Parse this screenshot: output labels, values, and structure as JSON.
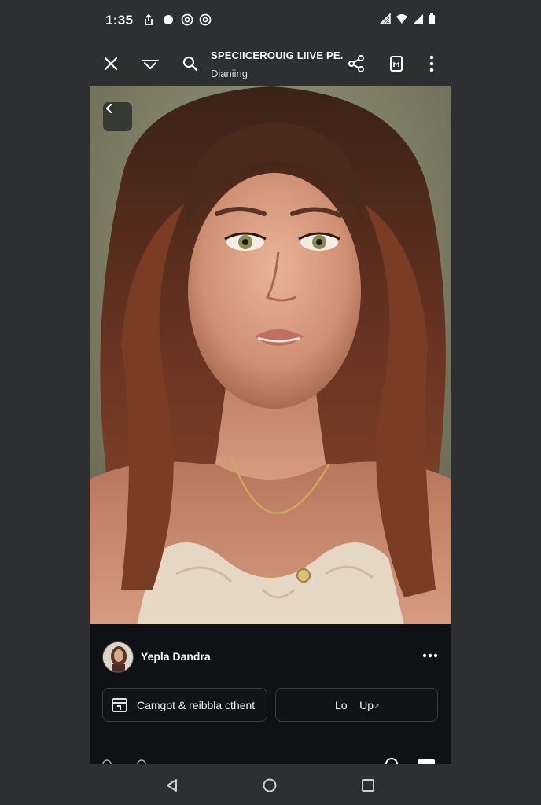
{
  "status_bar": {
    "time": "1:35",
    "left_icons": [
      "upload-icon",
      "dot-icon",
      "record-icon",
      "record-icon"
    ],
    "right_icons": [
      "signal-strength-icon",
      "wifi-icon",
      "cell-signal-icon",
      "battery-icon"
    ]
  },
  "app_bar": {
    "title": "SPECIICEROUIG LIIVE PE.",
    "subtitle": "Dianiing",
    "icons": [
      "close-icon",
      "filter-icon",
      "search-icon",
      "share-icon",
      "bookmark-icon",
      "more-vert-icon"
    ]
  },
  "photo": {
    "description_icon": "portrait-photo",
    "back_icon": "chevron-left-icon"
  },
  "post": {
    "user_name": "Yepla Dandra",
    "actions": [
      {
        "label": "Camgot & reibbla cthent",
        "icon": "card-icon"
      },
      {
        "label": "Lo    Up",
        "suffix": "↗"
      }
    ]
  },
  "nav_bar": {
    "buttons": [
      "back-triangle-icon",
      "home-circle-icon",
      "recents-square-icon"
    ]
  },
  "colors": {
    "background": "#2e2f31",
    "sheet": "#101114",
    "text": "#ffffff"
  }
}
